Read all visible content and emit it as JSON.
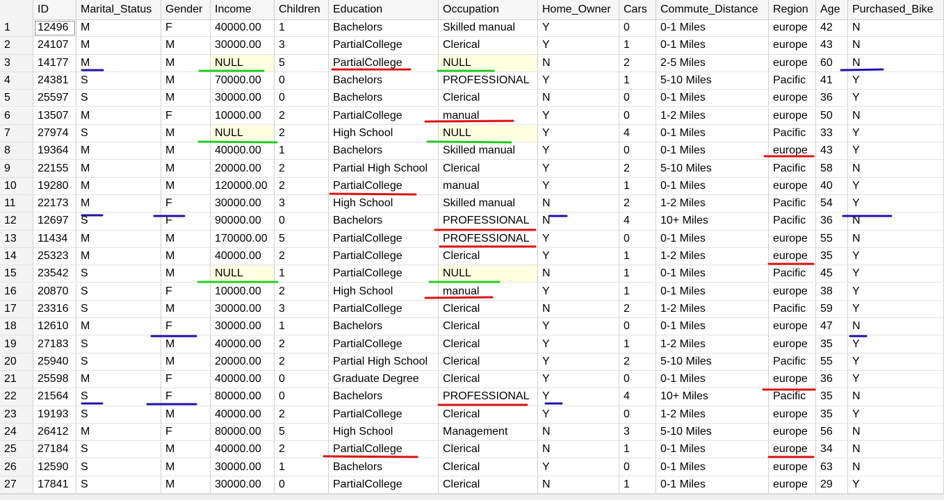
{
  "columns": [
    "",
    "ID",
    "Marital_Status",
    "Gender",
    "Income",
    "Children",
    "Education",
    "Occupation",
    "Home_Owner",
    "Cars",
    "Commute_Distance",
    "Region",
    "Age",
    "Purchased_Bike"
  ],
  "rows": [
    [
      "1",
      "12496",
      "M",
      "F",
      "40000.00",
      "1",
      "Bachelors",
      "Skilled manual",
      "Y",
      "0",
      "0-1 Miles",
      "europe",
      "42",
      "N"
    ],
    [
      "2",
      "24107",
      "M",
      "M",
      "30000.00",
      "3",
      "PartialCollege",
      "Clerical",
      "Y",
      "1",
      "0-1 Miles",
      "europe",
      "43",
      "N"
    ],
    [
      "3",
      "14177",
      "M",
      "M",
      "NULL",
      "5",
      "PartialCollege",
      "NULL",
      "N",
      "2",
      "2-5 Miles",
      "europe",
      "60",
      "N"
    ],
    [
      "4",
      "24381",
      "S",
      "M",
      "70000.00",
      "0",
      "Bachelors",
      "PROFESSIONAL",
      "Y",
      "1",
      "5-10 Miles",
      "Pacific",
      "41",
      "Y"
    ],
    [
      "5",
      "25597",
      "S",
      "M",
      "30000.00",
      "0",
      "Bachelors",
      "Clerical",
      "N",
      "0",
      "0-1 Miles",
      "europe",
      "36",
      "Y"
    ],
    [
      "6",
      "13507",
      "M",
      "F",
      "10000.00",
      "2",
      "PartialCollege",
      "manual",
      "Y",
      "0",
      "1-2 Miles",
      "europe",
      "50",
      "N"
    ],
    [
      "7",
      "27974",
      "S",
      "M",
      "NULL",
      "2",
      "High School",
      "NULL",
      "Y",
      "4",
      "0-1 Miles",
      "Pacific",
      "33",
      "Y"
    ],
    [
      "8",
      "19364",
      "M",
      "M",
      "40000.00",
      "1",
      "Bachelors",
      "Skilled manual",
      "Y",
      "0",
      "0-1 Miles",
      "europe",
      "43",
      "Y"
    ],
    [
      "9",
      "22155",
      "M",
      "M",
      "20000.00",
      "2",
      "Partial High School",
      "Clerical",
      "Y",
      "2",
      "5-10 Miles",
      "Pacific",
      "58",
      "N"
    ],
    [
      "10",
      "19280",
      "M",
      "M",
      "120000.00",
      "2",
      "PartialCollege",
      "manual",
      "Y",
      "1",
      "0-1 Miles",
      "europe",
      "40",
      "Y"
    ],
    [
      "11",
      "22173",
      "M",
      "F",
      "30000.00",
      "3",
      "High School",
      "Skilled manual",
      "N",
      "2",
      "1-2 Miles",
      "Pacific",
      "54",
      "Y"
    ],
    [
      "12",
      "12697",
      "S",
      "F",
      "90000.00",
      "0",
      "Bachelors",
      "PROFESSIONAL",
      "N",
      "4",
      "10+ Miles",
      "Pacific",
      "36",
      "N"
    ],
    [
      "13",
      "11434",
      "M",
      "M",
      "170000.00",
      "5",
      "PartialCollege",
      "PROFESSIONAL",
      "Y",
      "0",
      "0-1 Miles",
      "europe",
      "55",
      "N"
    ],
    [
      "14",
      "25323",
      "M",
      "M",
      "40000.00",
      "2",
      "PartialCollege",
      "Clerical",
      "Y",
      "1",
      "1-2 Miles",
      "europe",
      "35",
      "Y"
    ],
    [
      "15",
      "23542",
      "S",
      "M",
      "NULL",
      "1",
      "PartialCollege",
      "NULL",
      "N",
      "1",
      "0-1 Miles",
      "Pacific",
      "45",
      "Y"
    ],
    [
      "16",
      "20870",
      "S",
      "F",
      "10000.00",
      "2",
      "High School",
      "manual",
      "Y",
      "1",
      "0-1 Miles",
      "europe",
      "38",
      "Y"
    ],
    [
      "17",
      "23316",
      "S",
      "M",
      "30000.00",
      "3",
      "PartialCollege",
      "Clerical",
      "N",
      "2",
      "1-2 Miles",
      "Pacific",
      "59",
      "Y"
    ],
    [
      "18",
      "12610",
      "M",
      "F",
      "30000.00",
      "1",
      "Bachelors",
      "Clerical",
      "Y",
      "0",
      "0-1 Miles",
      "europe",
      "47",
      "N"
    ],
    [
      "19",
      "27183",
      "S",
      "M",
      "40000.00",
      "2",
      "PartialCollege",
      "Clerical",
      "Y",
      "1",
      "1-2 Miles",
      "europe",
      "35",
      "Y"
    ],
    [
      "20",
      "25940",
      "S",
      "M",
      "20000.00",
      "2",
      "Partial High School",
      "Clerical",
      "Y",
      "2",
      "5-10 Miles",
      "Pacific",
      "55",
      "Y"
    ],
    [
      "21",
      "25598",
      "M",
      "F",
      "40000.00",
      "0",
      "Graduate Degree",
      "Clerical",
      "Y",
      "0",
      "0-1 Miles",
      "europe",
      "36",
      "Y"
    ],
    [
      "22",
      "21564",
      "S",
      "F",
      "80000.00",
      "0",
      "Bachelors",
      "PROFESSIONAL",
      "Y",
      "4",
      "10+ Miles",
      "Pacific",
      "35",
      "N"
    ],
    [
      "23",
      "19193",
      "S",
      "M",
      "40000.00",
      "2",
      "PartialCollege",
      "Clerical",
      "Y",
      "0",
      "1-2 Miles",
      "europe",
      "35",
      "Y"
    ],
    [
      "24",
      "26412",
      "M",
      "F",
      "80000.00",
      "5",
      "High School",
      "Management",
      "N",
      "3",
      "5-10 Miles",
      "europe",
      "56",
      "N"
    ],
    [
      "25",
      "27184",
      "S",
      "M",
      "40000.00",
      "2",
      "PartialCollege",
      "Clerical",
      "N",
      "1",
      "0-1 Miles",
      "europe",
      "34",
      "N"
    ],
    [
      "26",
      "12590",
      "S",
      "M",
      "30000.00",
      "1",
      "Bachelors",
      "Clerical",
      "Y",
      "0",
      "0-1 Miles",
      "europe",
      "63",
      "N"
    ],
    [
      "27",
      "17841",
      "S",
      "M",
      "30000.00",
      "0",
      "PartialCollege",
      "Clerical",
      "N",
      "1",
      "0-1 Miles",
      "europe",
      "29",
      "Y"
    ]
  ],
  "colors": {
    "missing_value_mark": "#22cc22",
    "inconsistent_value_mark": "#dd1111",
    "category_mark": "#2211aa",
    "null_cell_bg": "#ffffe1"
  }
}
